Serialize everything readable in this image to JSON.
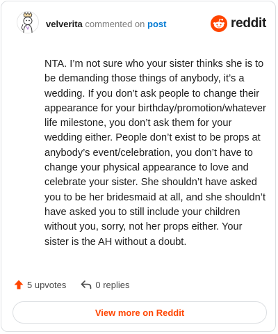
{
  "comment": {
    "username": "velverita",
    "action_text": "commented on",
    "post_link_label": "post",
    "body": "NTA. I’m not sure who your sister thinks she is to be demanding those things of anybody, it’s a wedding. If you don’t ask people to change their appearance for your birthday/promotion/whatever life milestone, you don’t ask them for your wedding either. People don’t exist to be props at anybody’s event/celebration, you don’t have to change your physical appearance to love and celebrate your sister. She shouldn’t have asked you to be her bridesmaid at all, and she shouldn’t have asked you to still include your children without you, sorry, not her props either. Your sister is the AH without a doubt."
  },
  "brand": {
    "logo_text": "reddit",
    "logo_icon": "reddit-snoo-icon",
    "color": "#ff4500"
  },
  "stats": {
    "upvotes_label": "5 upvotes",
    "upvote_icon": "upvote-arrow-icon",
    "replies_label": "0 replies",
    "reply_icon": "reply-arrow-icon"
  },
  "footer": {
    "view_more_label": "View more on Reddit"
  },
  "colors": {
    "accent": "#ff4500",
    "link": "#0079d3",
    "text": "#1c1c1c",
    "muted": "#7c7c7c",
    "border": "#dcdfe2"
  }
}
